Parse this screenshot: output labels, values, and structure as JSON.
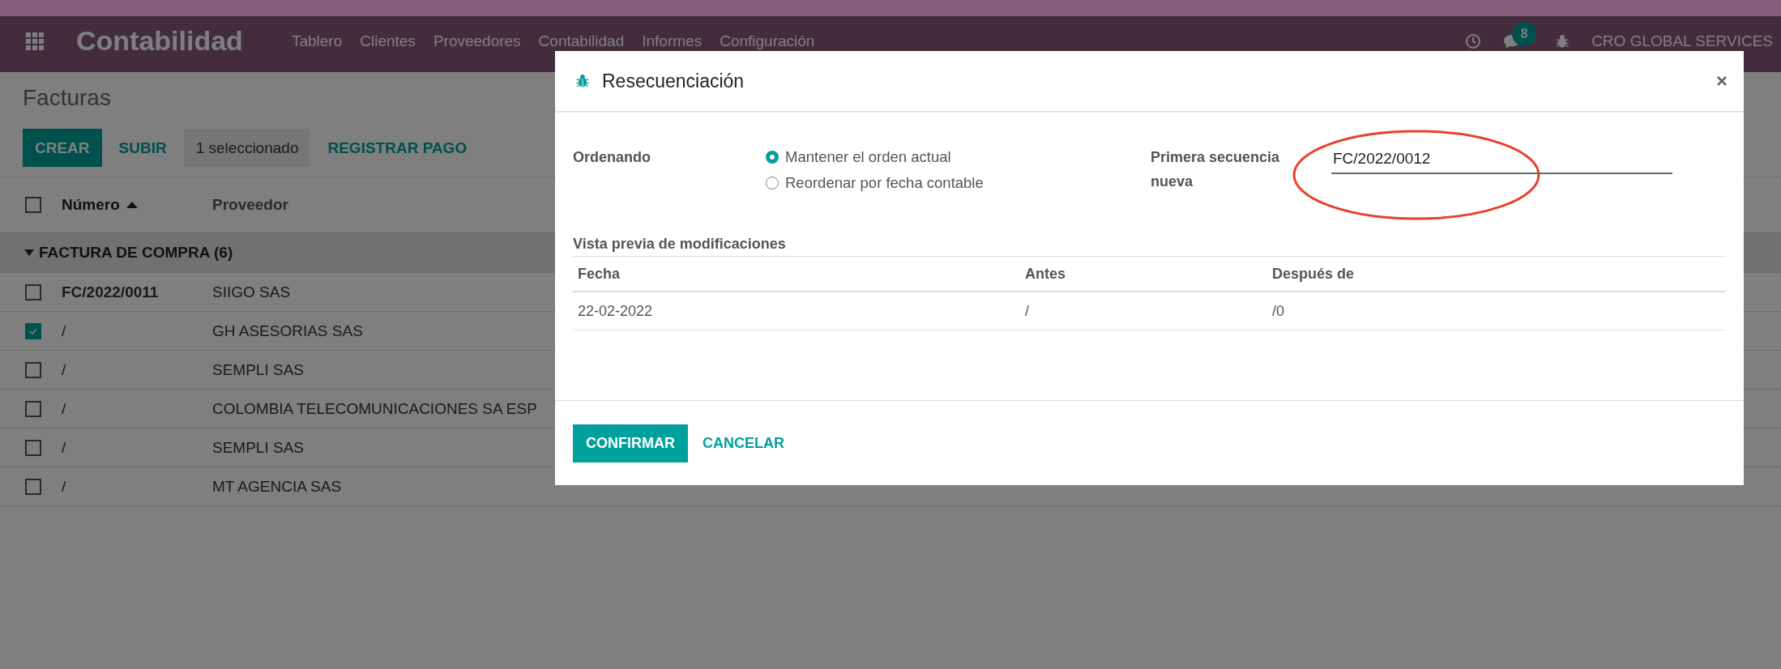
{
  "navbar": {
    "app_title": "Contabilidad",
    "menu": [
      "Tablero",
      "Clientes",
      "Proveedores",
      "Contabilidad",
      "Informes",
      "Configuración"
    ],
    "notification_count": "8",
    "company": "CRO GLOBAL SERVICES"
  },
  "page": {
    "title": "Facturas",
    "buttons": [
      {
        "label": "CREAR",
        "kind": "primary"
      },
      {
        "label": "SUBIR",
        "kind": "link"
      },
      {
        "label": "1 seleccionado",
        "kind": "info"
      },
      {
        "label": "REGISTRAR PAGO",
        "kind": "link"
      }
    ]
  },
  "table": {
    "select_all_checked": false,
    "columns": [
      {
        "label": "Número",
        "sorted": true
      },
      {
        "label": "Proveedor",
        "sorted": false
      }
    ],
    "group": {
      "label": "FACTURA DE COMPRA (6)",
      "expanded": true
    },
    "rows": [
      {
        "numero": "FC/2022/0011",
        "proveedor": "SIIGO SAS",
        "selected": false
      },
      {
        "numero": "/",
        "proveedor": "GH ASESORIAS SAS",
        "selected": true
      },
      {
        "numero": "/",
        "proveedor": "SEMPLI SAS",
        "selected": false
      },
      {
        "numero": "/",
        "proveedor": "COLOMBIA TELECOMUNICACIONES SA ESP",
        "selected": false
      },
      {
        "numero": "/",
        "proveedor": "SEMPLI SAS",
        "selected": false
      },
      {
        "numero": "/",
        "proveedor": "MT AGENCIA SAS",
        "selected": false
      }
    ]
  },
  "dialog": {
    "title": "Resecuenciación",
    "ordering": {
      "label": "Ordenando",
      "options": [
        {
          "label": "Mantener el orden actual",
          "selected": true
        },
        {
          "label": "Reordenar por fecha contable",
          "selected": false
        }
      ]
    },
    "first_sequence": {
      "label": "Primera secuencia nueva",
      "value": "FC/2022/0012",
      "annotated": true
    },
    "preview": {
      "title": "Vista previa de modificaciones",
      "columns": [
        "Fecha",
        "Antes",
        "Después de"
      ],
      "rows": [
        [
          "22-02-2022",
          "/",
          "/0"
        ]
      ]
    },
    "buttons": [
      {
        "label": "CONFIRMAR",
        "kind": "primary"
      },
      {
        "label": "CANCELAR",
        "kind": "link"
      }
    ]
  }
}
